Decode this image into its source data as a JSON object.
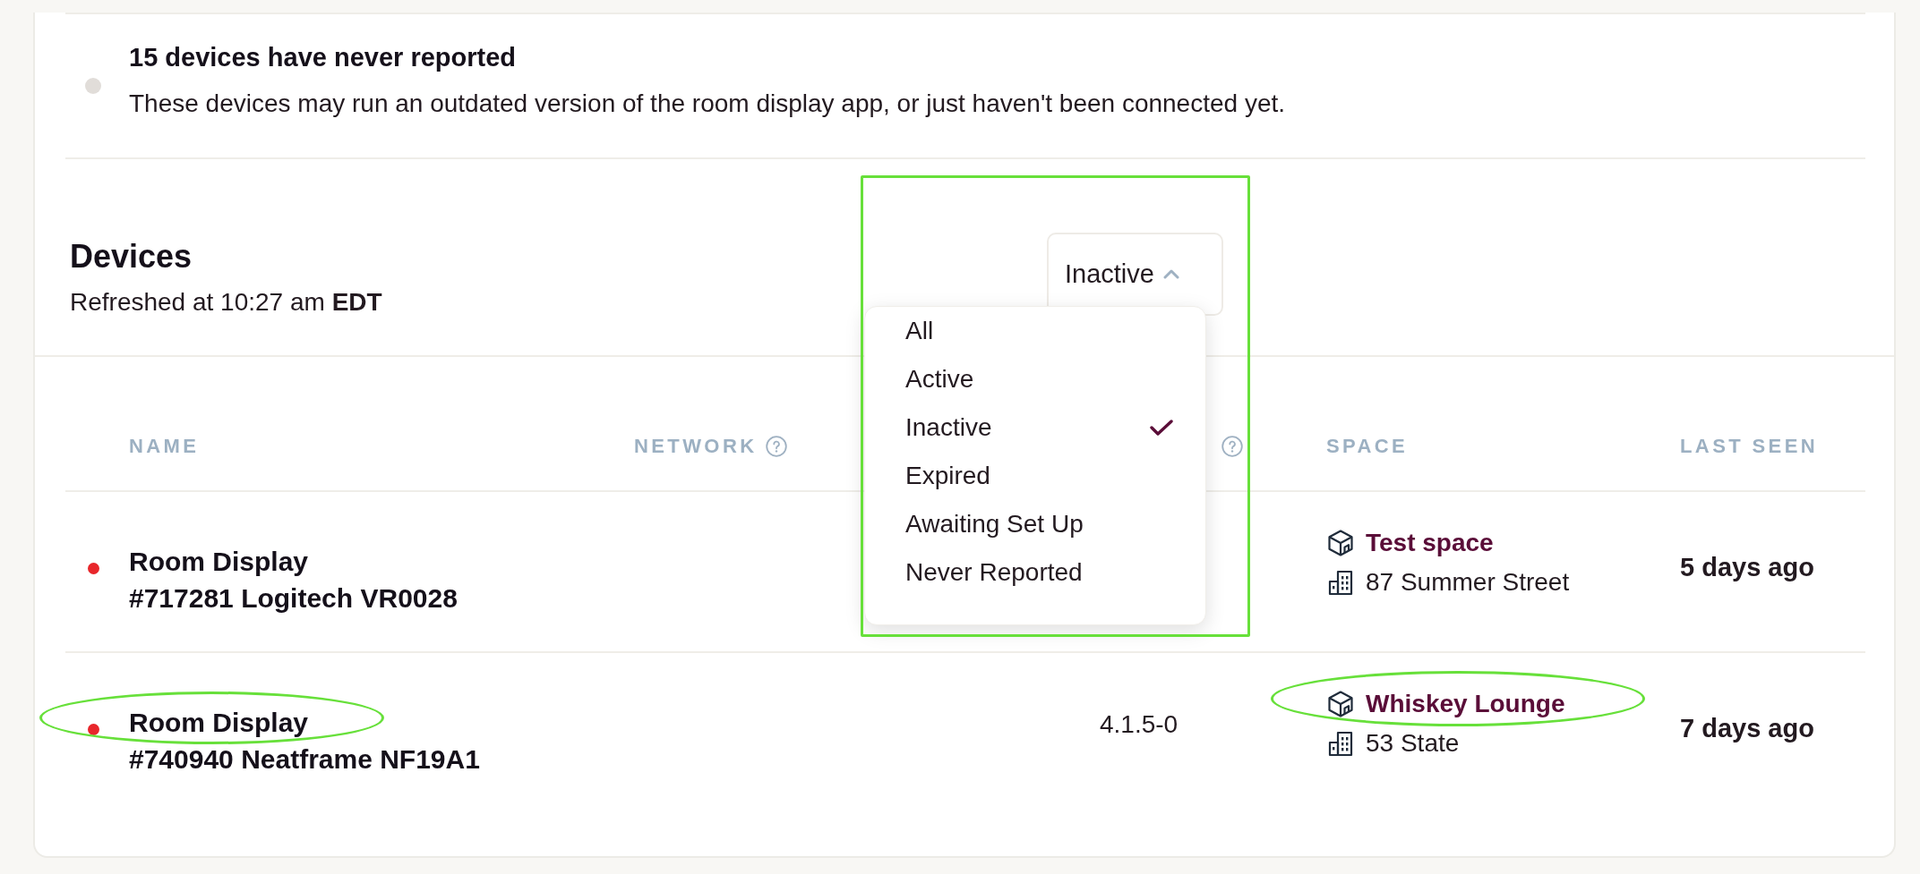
{
  "notices": [
    {
      "color": "#e1ddd9",
      "title": "15 devices have never reported",
      "text": "These devices may run an outdated version of the room display app, or just haven't been connected yet."
    }
  ],
  "devices": {
    "title": "Devices",
    "refreshed": "Refreshed at 10:27 am **EDT**",
    "filter": {
      "value": "Inactive",
      "expanded": true,
      "highlight": {
        "kind": "rectangle"
      },
      "options": [
        {
          "label": "All",
          "selected": false
        },
        {
          "label": "Active",
          "selected": false
        },
        {
          "label": "Inactive",
          "selected": true
        },
        {
          "label": "Expired",
          "selected": false
        },
        {
          "label": "Awaiting Set Up",
          "selected": false
        },
        {
          "label": "Never Reported",
          "selected": false
        }
      ]
    },
    "table": {
      "columns": [
        {
          "label": "NAME",
          "help": false
        },
        {
          "label": "NETWORK",
          "help": true
        },
        {
          "help": true
        },
        {
          "label": "SPACE",
          "help": false
        },
        {
          "label": "LAST SEEN",
          "help": false
        }
      ],
      "rows": [
        {
          "color": "#e8262b",
          "name": "Room Display",
          "model": "#717281 Logitech VR0028",
          "space": "Test space",
          "address": "87 Summer Street",
          "last_seen": "5 days ago"
        },
        {
          "color": "#e8262b",
          "name": "Room Display",
          "name_highlight": {
            "kind": "ellipse"
          },
          "model": "#740940 Neatframe NF19A1",
          "column_3": "4.1.5-0",
          "space": "Whiskey Lounge",
          "space_highlight": {
            "kind": "ellipse"
          },
          "address": "53 State",
          "last_seen": "7 days ago"
        }
      ]
    }
  }
}
